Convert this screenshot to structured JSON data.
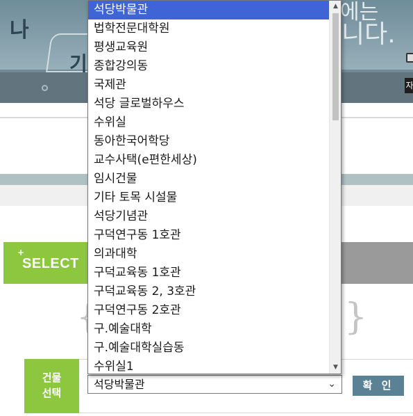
{
  "banner": {
    "glyph_left_top": "나",
    "glyph_left_bottom": "기",
    "text_right_top": "에는",
    "text_right_bottom": "니다.",
    "badge_char": "자"
  },
  "select_section": {
    "plus": "+",
    "title": "SELECT"
  },
  "building_select": {
    "label_line1": "건물",
    "label_line2": "선택",
    "selected_value": "석당박물관",
    "confirm_label": "확 인"
  },
  "dropdown": {
    "options": [
      "석당박물관",
      "법학전문대학원",
      "평생교육원",
      "종합강의동",
      "국제관",
      "석당 글로벌하우스",
      "수위실",
      "동아한국어학당",
      "교수사택(e편한세상)",
      "임시건물",
      "기타 토목 시설물",
      "석당기념관",
      "구덕연구동 1호관",
      "의과대학",
      "구덕교육동 1호관",
      "구덕교육동 2, 3호관",
      "구덕연구동 2호관",
      "구.예술대학",
      "구.예술대학실습동",
      "수위실1"
    ],
    "selected_index": 0
  },
  "colors": {
    "accent_green": "#8dc63f",
    "selected_blue": "#3e64d6",
    "button_blue": "#5a8194"
  },
  "icons": [
    "chevron-down-icon",
    "scroll-up-arrow-icon",
    "scroll-down-arrow-icon",
    "banner-dot-icon"
  ]
}
